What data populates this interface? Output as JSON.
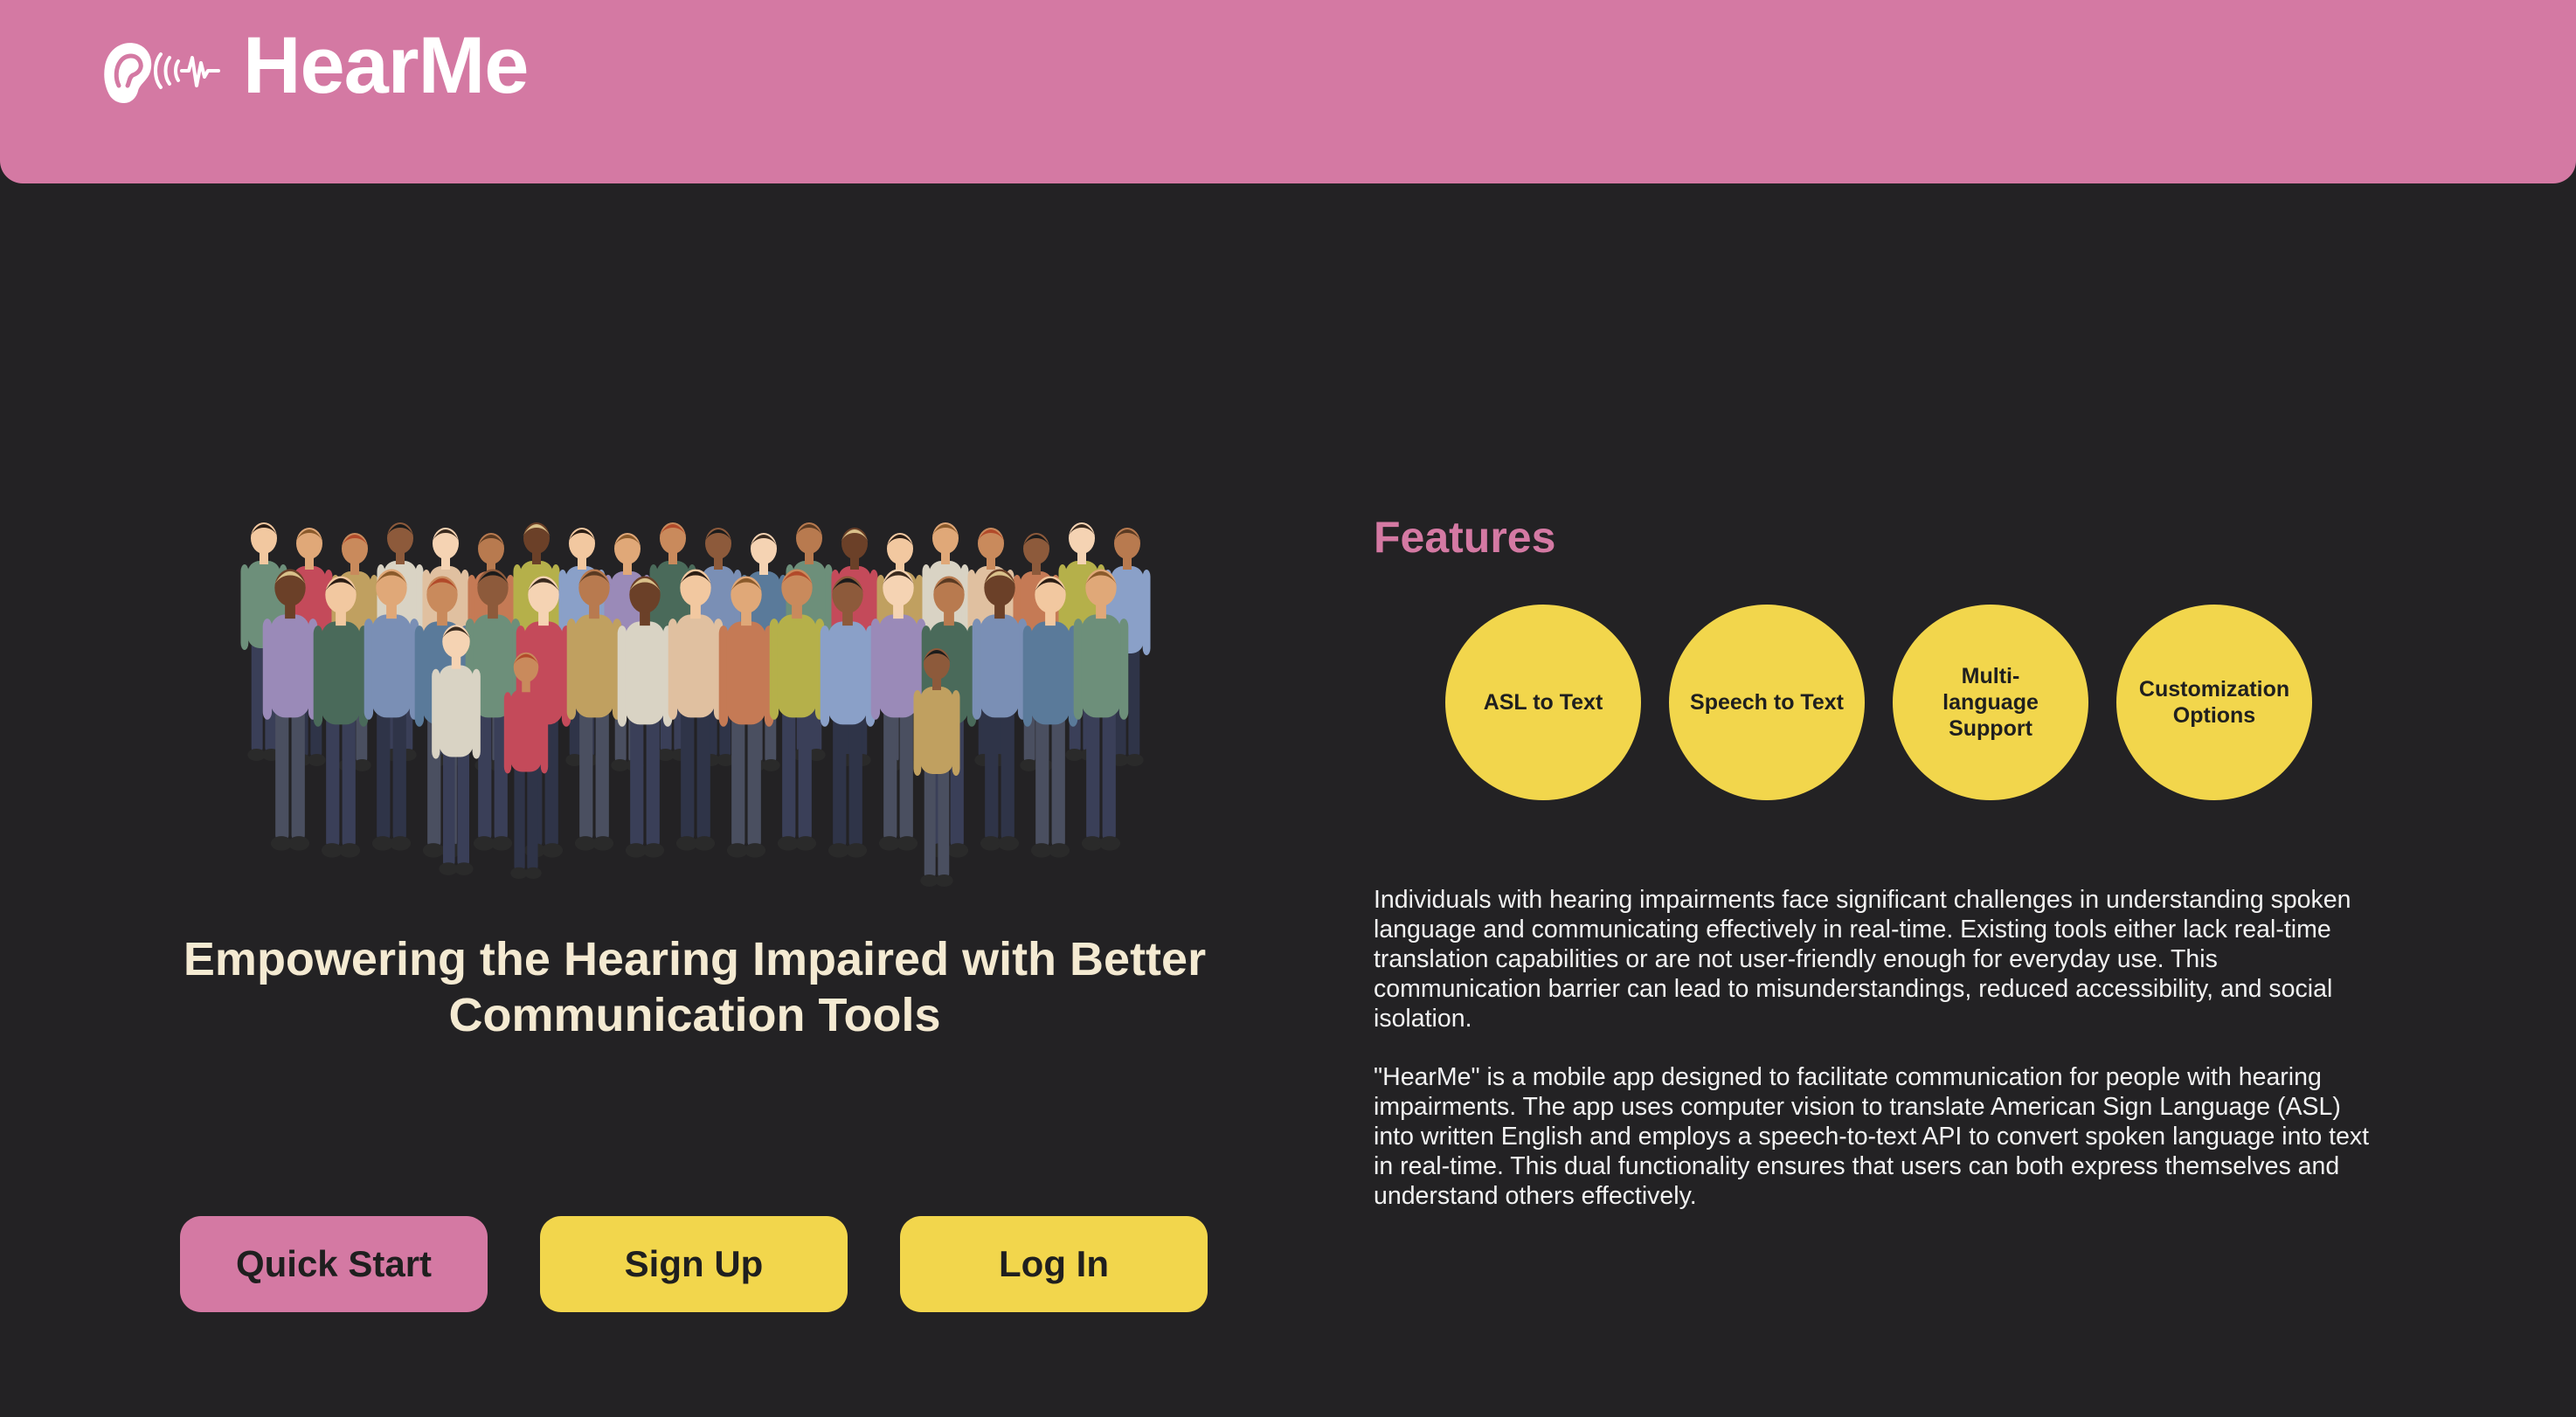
{
  "header": {
    "logo_icon": "ear-soundwave-icon",
    "app_name": "HearMe",
    "color": "#d479a3"
  },
  "hero": {
    "illustration": "diverse-crowd-illustration",
    "heading": "Empowering the Hearing Impaired with Better Communication Tools"
  },
  "buttons": {
    "quick_start": "Quick Start",
    "sign_up": "Sign Up",
    "log_in": "Log In"
  },
  "features": {
    "title": "Features",
    "items": [
      {
        "label": "ASL to Text"
      },
      {
        "label": "Speech to Text"
      },
      {
        "label": "Multi-language Support"
      },
      {
        "label": "Customization Options"
      }
    ]
  },
  "description": {
    "paragraph_1": "Individuals with hearing impairments face significant challenges in understanding spoken language and communicating effectively in real-time. Existing tools either lack real-time translation capabilities or are not user-friendly enough for everyday use. This communication barrier can lead to misunderstandings, reduced accessibility, and social isolation.",
    "paragraph_2": "\"HearMe\" is a mobile app designed to facilitate communication for people with hearing impairments. The app uses computer vision to translate American Sign Language (ASL) into written English and employs a speech-to-text API to convert spoken language into text in real-time. This dual functionality ensures that users can both express themselves and understand others effectively."
  },
  "colors": {
    "background": "#232224",
    "accent_pink": "#d479a3",
    "accent_yellow": "#f2d64c",
    "heading_cream": "#f4ead2"
  }
}
